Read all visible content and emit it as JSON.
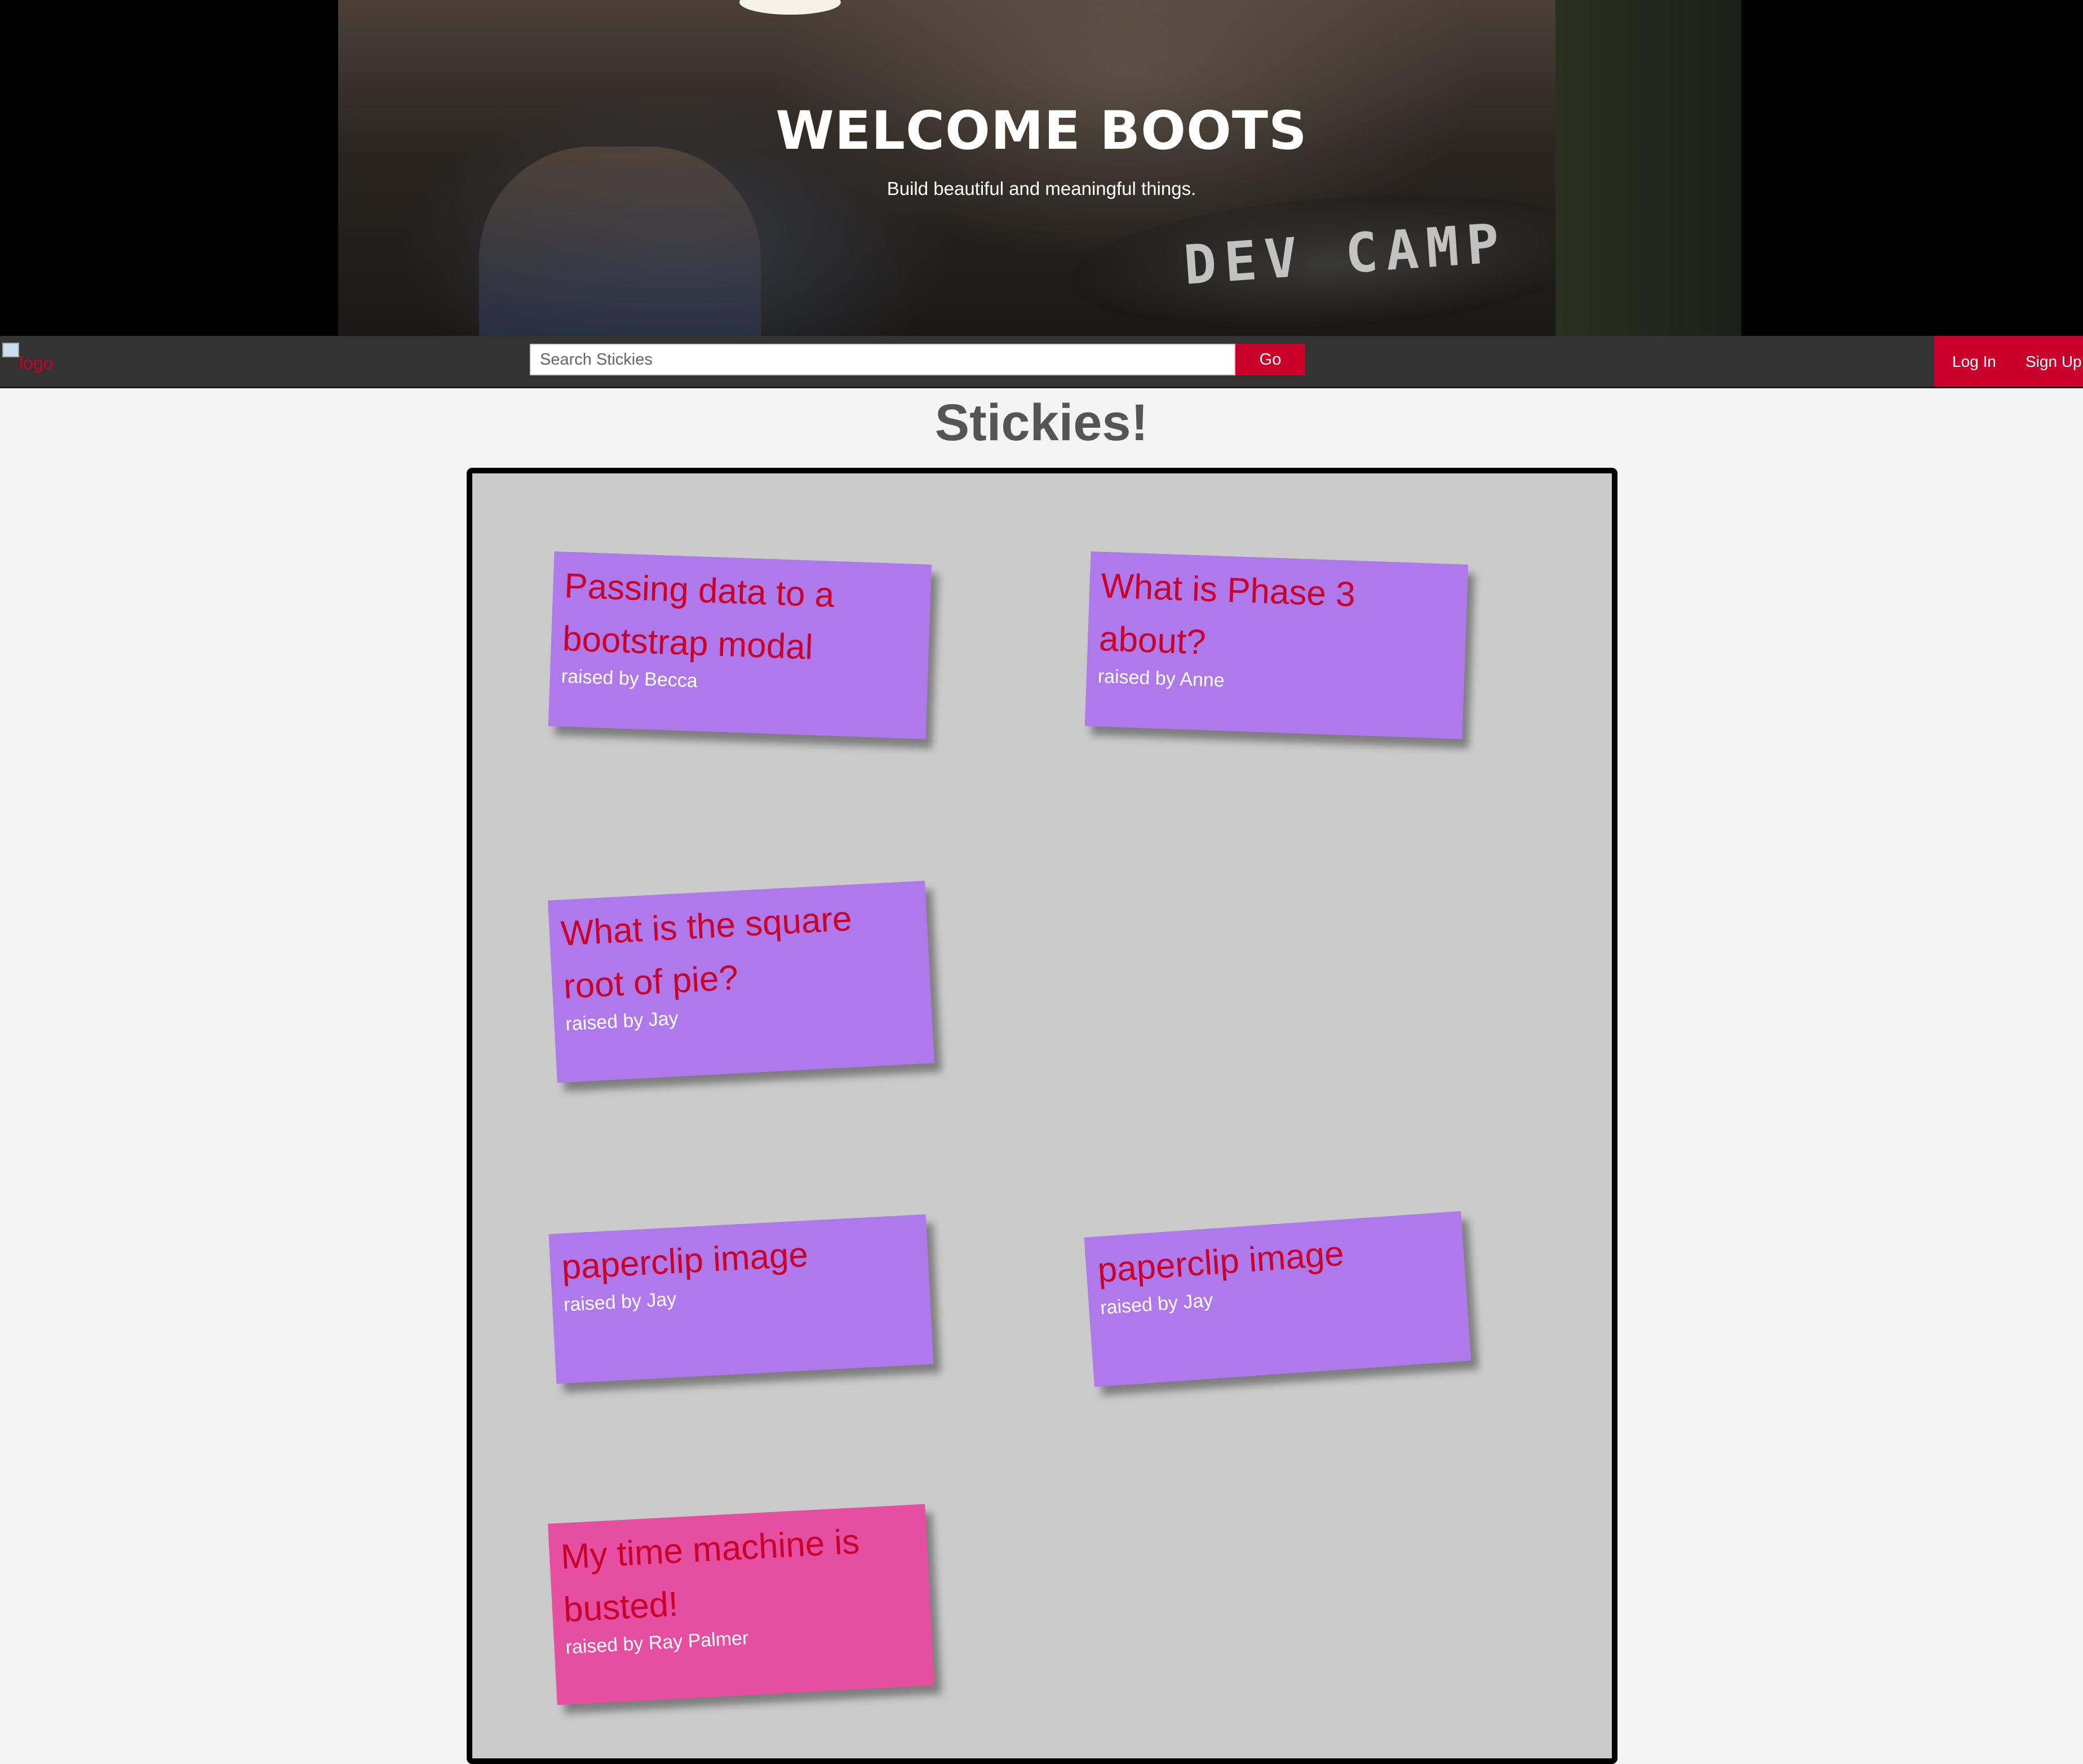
{
  "hero": {
    "title": "WELCOME BOOTS",
    "subtitle": "Build beautiful and meaningful things.",
    "background_art_text": "DEV CAMP"
  },
  "navbar": {
    "logo_alt": "logo",
    "search_placeholder": "Search Stickies",
    "go_label": "Go",
    "login_label": "Log In",
    "signup_label": "Sign Up"
  },
  "main": {
    "title": "Stickies!",
    "stickies": [
      {
        "question": "Passing data to a bootstrap modal",
        "raised_by": "raised by Becca",
        "color": "#af79ec"
      },
      {
        "question": "What is Phase 3 about?",
        "raised_by": "raised by Anne",
        "color": "#af79ec"
      },
      {
        "question": "What is the square root of pie?",
        "raised_by": "raised by Jay",
        "color": "#af79ec"
      },
      {
        "question": "paperclip image",
        "raised_by": "raised by Jay",
        "color": "#af79ec"
      },
      {
        "question": "paperclip image",
        "raised_by": "raised by Jay",
        "color": "#af79ec"
      },
      {
        "question": "My time machine is busted!",
        "raised_by": "raised by Ray Palmer",
        "color": "#e54ea1"
      }
    ]
  },
  "colors": {
    "accent": "#c8002a",
    "navbar": "#333333",
    "board": "#cbcbcb",
    "page_bg": "#f4f4f4"
  }
}
